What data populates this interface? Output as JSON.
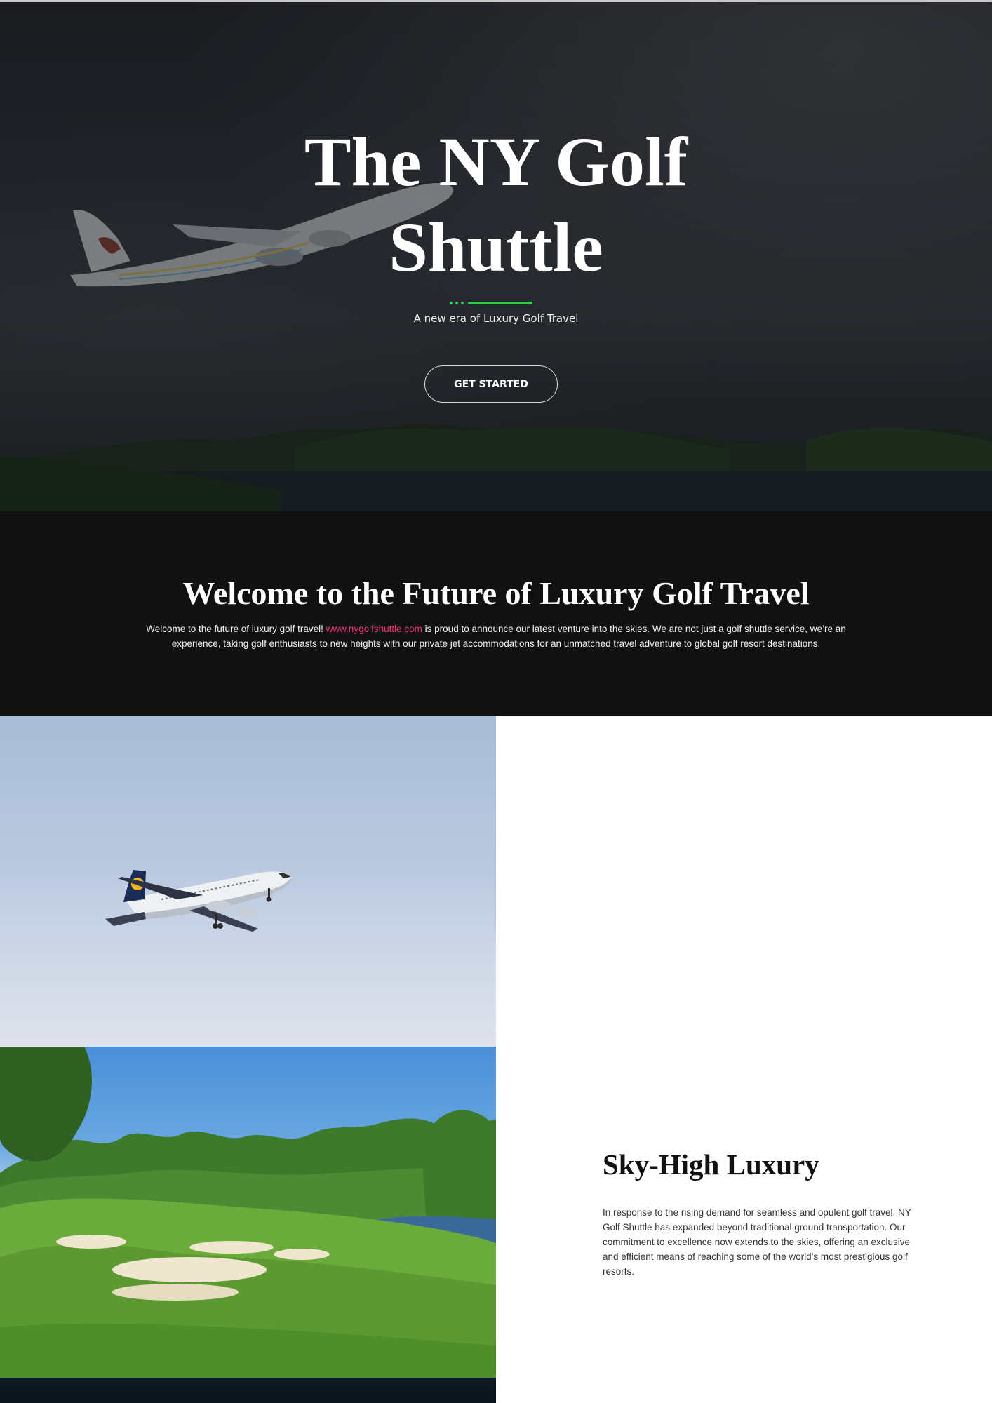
{
  "hero": {
    "title_line1": "The NY Golf",
    "title_line2": "Shuttle",
    "subtitle": "A new era of Luxury Golf Travel",
    "button_label": "GET STARTED"
  },
  "welcome": {
    "title": "Welcome to the Future of Luxury Golf Travel",
    "text_before_link": "Welcome to the future of luxury golf travel! ",
    "link_text": "www.nygolfshuttle.com",
    "text_after_link": " is proud to announce our latest venture into the skies. We are not just a golf shuttle service, we’re an experience, taking golf enthusiasts to new heights with our private jet accommodations for an unmatched travel adventure to global golf resort destinations."
  },
  "feature": {
    "title": "Sky-High Luxury",
    "body": "In response to the rising demand for seamless and opulent golf travel, NY Golf Shuttle has expanded beyond traditional ground transportation. Our commitment to excellence now extends to the skies, offering an exclusive and efficient means of reaching some of the world’s most prestigious golf resorts."
  },
  "colors": {
    "accent_green": "#2ecc52",
    "link_pink": "#e8347a",
    "dark_section": "#111111"
  }
}
